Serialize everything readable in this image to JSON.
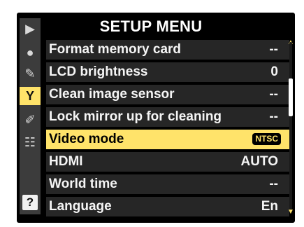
{
  "menu": {
    "title": "SETUP MENU",
    "items": [
      {
        "label": "Format memory card",
        "value": "--"
      },
      {
        "label": "LCD brightness",
        "value": "0"
      },
      {
        "label": "Clean image sensor",
        "value": "--"
      },
      {
        "label": "Lock mirror up for cleaning",
        "value": "--"
      },
      {
        "label": "Video mode",
        "value": "NTSC"
      },
      {
        "label": "HDMI",
        "value": "AUTO"
      },
      {
        "label": "World time",
        "value": "--"
      },
      {
        "label": "Language",
        "value": "En"
      }
    ]
  },
  "tabs": {
    "help_label": "?"
  },
  "colors": {
    "accent": "#ffe36a",
    "background": "#000000",
    "row_background": "#262626"
  }
}
